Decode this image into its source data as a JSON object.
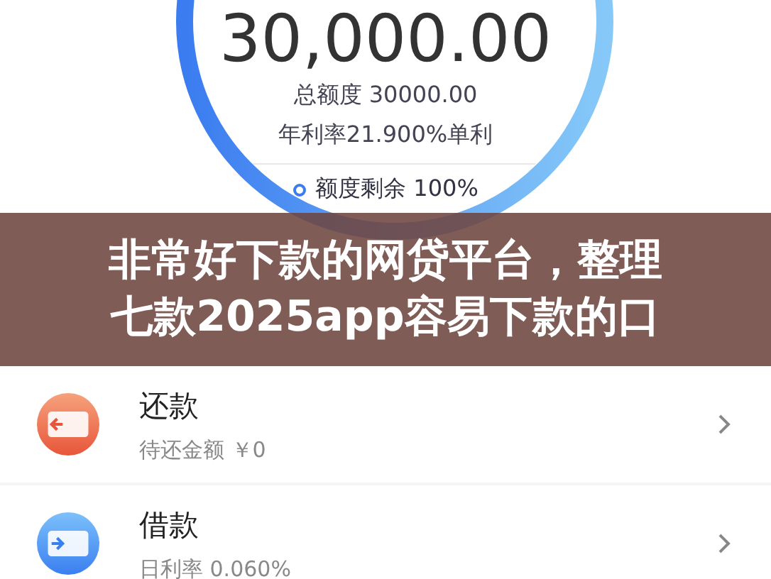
{
  "balance": {
    "amount": "30,000.00",
    "total": "总额度 30000.00",
    "rate": "年利率21.900%单利",
    "remaining": "额度剩余 100%"
  },
  "banner": {
    "lines": [
      "非常好下款的网贷平台，整理",
      "七款2025app容易下款的口"
    ]
  },
  "menu": [
    {
      "kind": "repay",
      "title": "还款",
      "subtitle": "待还金额 ￥0"
    },
    {
      "kind": "borrow",
      "title": "借款",
      "subtitle": "日利率 0.060%"
    }
  ]
}
